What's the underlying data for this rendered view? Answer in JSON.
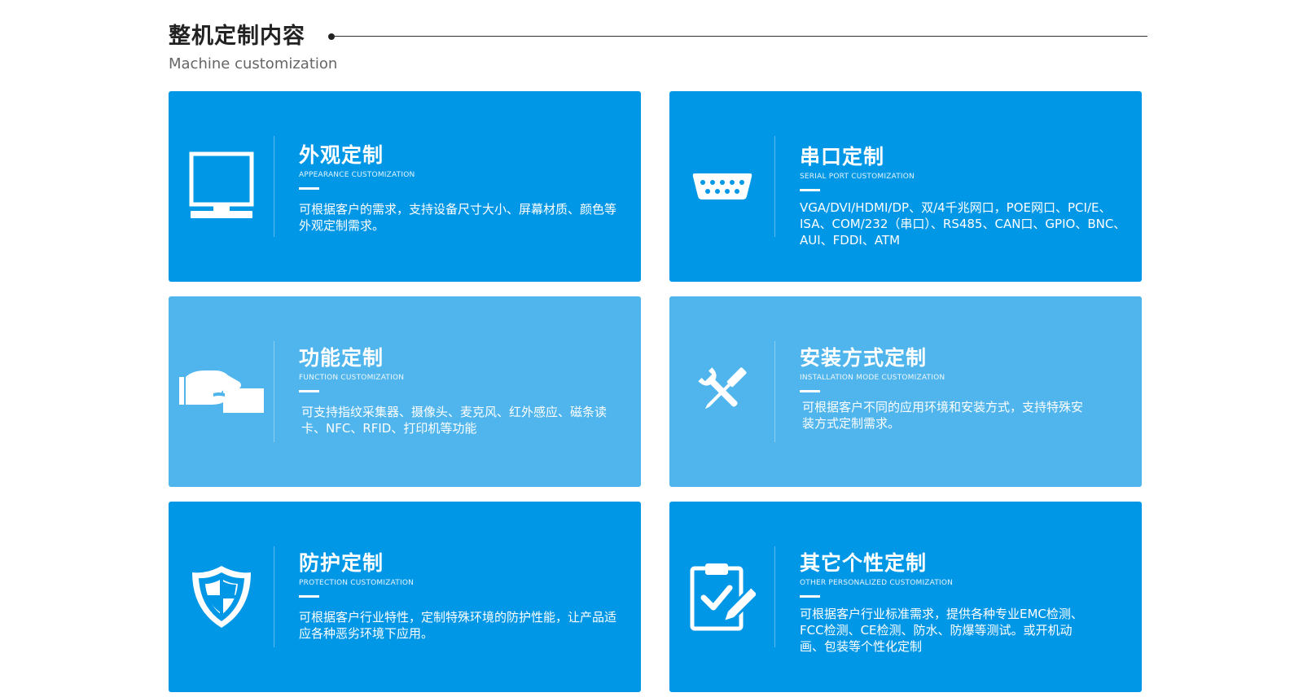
{
  "header": {
    "title": "整机定制内容",
    "subtitle": "Machine customization"
  },
  "cards": [
    {
      "title": "外观定制",
      "subtitle": "APPEARANCE CUSTOMIZATION",
      "desc": "可根据客户的需求，支持设备尺寸大小、屏幕材质、颜色等外观定制需求。",
      "icon": "monitor-icon"
    },
    {
      "title": "串口定制",
      "subtitle": "SERIAL PORT CUSTOMIZATION",
      "desc": "VGA/DVI/HDMI/DP、双/4千兆网口，POE网口、PCI/E、ISA、COM/232（串口）、RS485、CAN口、GPIO、BNC、AUI、FDDI、ATM",
      "icon": "serial-port-icon"
    },
    {
      "title": "功能定制",
      "subtitle": "FUNCTION CUSTOMIZATION",
      "desc": "可支持指纹采集器、摄像头、麦克风、红外感应、磁条读卡、NFC、RFID、打印机等功能",
      "icon": "hand-card-icon"
    },
    {
      "title": "安装方式定制",
      "subtitle": "INSTALLATION MODE CUSTOMIZATION",
      "desc": "可根据客户不同的应用环境和安装方式，支持特殊安装方式定制需求。",
      "icon": "tools-icon"
    },
    {
      "title": "防护定制",
      "subtitle": "PROTECTION CUSTOMIZATION",
      "desc": "可根据客户行业特性，定制特殊环境的防护性能，让产品适应各种恶劣环境下应用。",
      "icon": "shield-icon"
    },
    {
      "title": "其它个性定制",
      "subtitle": "OTHER PERSONALIZED CUSTOMIZATION",
      "desc": "可根据客户行业标准需求，提供各种专业EMC检测、FCC检测、CE检测、防水、防爆等测试。或开机动画、包装等个性化定制",
      "icon": "clipboard-edit-icon"
    }
  ],
  "colors": {
    "card_dark": "#0097e6",
    "card_light": "#4fb5ec"
  }
}
